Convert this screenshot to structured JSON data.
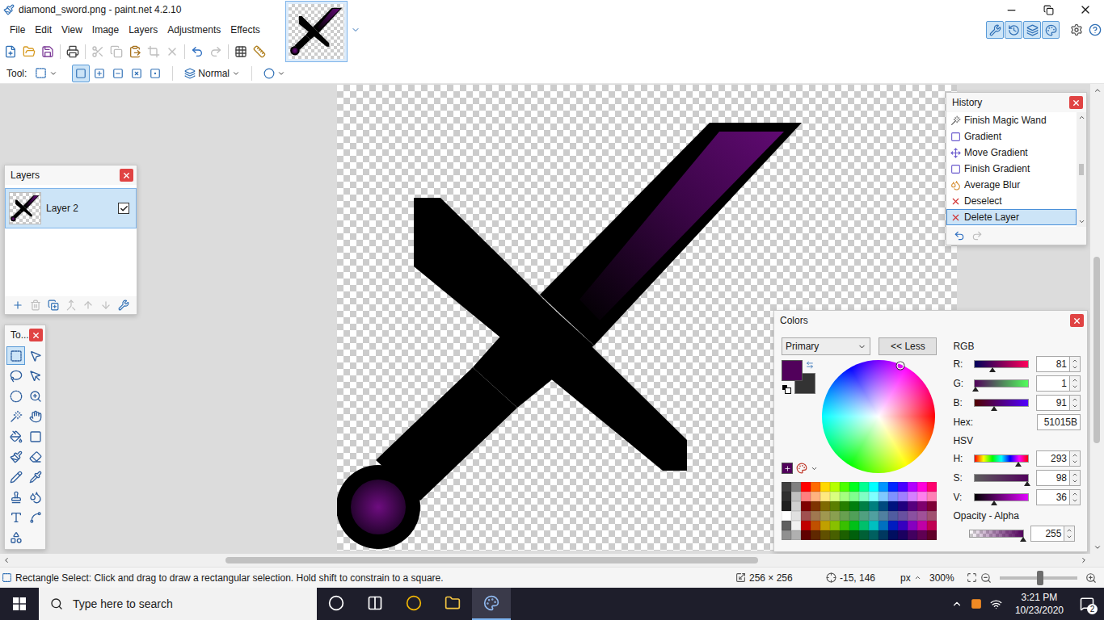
{
  "window": {
    "title": "diamond_sword.png - paint.net 4.2.10"
  },
  "menu": [
    "File",
    "Edit",
    "View",
    "Image",
    "Layers",
    "Adjustments",
    "Effects"
  ],
  "image_tabs": [
    {
      "selected": true
    }
  ],
  "panel_toggles": [
    {
      "selected": true
    },
    {
      "selected": true
    },
    {
      "selected": true
    },
    {
      "selected": true
    }
  ],
  "toolbar": [
    [
      {
        "disabled": false
      },
      {
        "disabled": false
      },
      {
        "disabled": false
      }
    ],
    [
      {
        "disabled": false
      }
    ],
    [
      {
        "disabled": true
      },
      {
        "disabled": true
      },
      {
        "disabled": false
      },
      {
        "disabled": true
      },
      {
        "disabled": true
      }
    ],
    [
      {
        "disabled": false
      },
      {
        "disabled": true
      }
    ],
    [
      {
        "disabled": false
      },
      {
        "disabled": false
      }
    ]
  ],
  "tool_options": {
    "label": "Tool:",
    "modes": [
      {
        "selected": true
      },
      {
        "selected": false
      },
      {
        "selected": false
      },
      {
        "selected": false
      },
      {
        "selected": false
      }
    ],
    "blend_mode": "Normal"
  },
  "layers_panel": {
    "title": "Layers",
    "layers": [
      {
        "name": "Layer 2",
        "visible": true,
        "selected": true
      }
    ],
    "buttons": [
      {
        "disabled": false
      },
      {
        "disabled": true
      },
      {
        "disabled": false
      },
      {
        "disabled": true
      },
      {
        "disabled": true
      },
      {
        "disabled": true
      },
      {
        "disabled": false
      }
    ]
  },
  "tools_panel": {
    "title": "To...",
    "tools": [
      {
        "selected": true
      },
      {
        "selected": false
      },
      {
        "selected": false
      },
      {
        "selected": false
      },
      {
        "selected": false
      },
      {
        "selected": false
      },
      {
        "selected": false
      },
      {
        "selected": false
      },
      {
        "selected": false
      },
      {
        "selected": false
      },
      {
        "selected": false
      },
      {
        "selected": false
      },
      {
        "selected": false
      },
      {
        "selected": false
      },
      {
        "selected": false
      },
      {
        "selected": false
      },
      {
        "selected": false
      },
      {
        "selected": false
      },
      {
        "selected": false
      }
    ]
  },
  "history_panel": {
    "title": "History",
    "items": [
      {
        "label": "Finish Magic Wand",
        "selected": false
      },
      {
        "label": "Gradient",
        "selected": false
      },
      {
        "label": "Move Gradient",
        "selected": false
      },
      {
        "label": "Finish Gradient",
        "selected": false
      },
      {
        "label": "Average Blur",
        "selected": false
      },
      {
        "label": "Deselect",
        "selected": false
      },
      {
        "label": "Delete Layer",
        "selected": true
      }
    ],
    "undo_disabled": false,
    "redo_disabled": true
  },
  "colors_panel": {
    "title": "Colors",
    "target": "Primary",
    "less_button": "<< Less",
    "primary": "#51015B",
    "secondary": "#333333",
    "rgb_label": "RGB",
    "rgb": [
      {
        "label": "R:",
        "value": "81",
        "level": 0.32,
        "kind": "red"
      },
      {
        "label": "G:",
        "value": "1",
        "level": 0.004,
        "kind": "green"
      },
      {
        "label": "B:",
        "value": "91",
        "level": 0.36,
        "kind": "blue"
      }
    ],
    "hex_label": "Hex:",
    "hex": "51015B",
    "hsv_label": "HSV",
    "hsv": [
      {
        "label": "H:",
        "value": "293",
        "level": 0.81,
        "kind": "hue"
      },
      {
        "label": "S:",
        "value": "98",
        "level": 0.98,
        "kind": "saturation"
      },
      {
        "label": "V:",
        "value": "36",
        "level": 0.36,
        "kind": "value"
      }
    ],
    "alpha_label": "Opacity - Alpha",
    "alpha": {
      "value": "255",
      "level": 1
    },
    "palette": [
      [
        "#404040",
        "#808080",
        "#ff0000",
        "#ff6a00",
        "#ffd800",
        "#b6ff00",
        "#4cff00",
        "#00ff21",
        "#00ff90",
        "#00ffff",
        "#0094ff",
        "#0026ff",
        "#4800ff",
        "#b200ff",
        "#ff00dc",
        "#ff006e"
      ],
      [
        "#303030",
        "#c0c0c0",
        "#ff7f7f",
        "#ffb27f",
        "#ffe97f",
        "#daff7f",
        "#a5ff7f",
        "#7fff8e",
        "#7fffc5",
        "#7fffff",
        "#7fc9ff",
        "#7f92ff",
        "#a17fff",
        "#d67fff",
        "#ff7fed",
        "#ff7fb6"
      ],
      [
        "#202020",
        "#d0d0d0",
        "#7f0000",
        "#7f3300",
        "#7f6a00",
        "#5b7f00",
        "#267f00",
        "#007f0e",
        "#007f46",
        "#007f7f",
        "#004a7f",
        "#00137f",
        "#21007f",
        "#57007f",
        "#7f006e",
        "#7f0037"
      ],
      [
        "#ffffff",
        "#e0e0e0",
        "#a05050",
        "#a07850",
        "#a09850",
        "#8aa050",
        "#68a050",
        "#50a058",
        "#50a080",
        "#50a0a0",
        "#5080a0",
        "#505ca0",
        "#6850a0",
        "#8a50a0",
        "#a05098",
        "#a05070"
      ],
      [
        "#606060",
        "#f0f0f0",
        "#c00000",
        "#c05000",
        "#c0a000",
        "#88c000",
        "#38c000",
        "#00c018",
        "#00c06c",
        "#00c0c0",
        "#0070c0",
        "#001cc0",
        "#3600c0",
        "#8600c0",
        "#c000a6",
        "#c00052"
      ],
      [
        "#909090",
        "#b0b0b0",
        "#600000",
        "#602800",
        "#605000",
        "#486000",
        "#1c6000",
        "#00600c",
        "#006036",
        "#006060",
        "#003860",
        "#000e60",
        "#1b0060",
        "#430060",
        "#600053",
        "#600029"
      ]
    ]
  },
  "scrollbars": {
    "vertical": {
      "start": 0.36,
      "size": 0.42
    },
    "horizontal": {
      "start": 0.2,
      "size": 0.5
    }
  },
  "status_bar": {
    "hint": "Rectangle Select: Click and drag to draw a rectangular selection. Hold shift to constrain to a square.",
    "image_size": "256 × 256",
    "cursor": "-15, 146",
    "unit": "px",
    "zoom": "300%",
    "zoom_level": 0.52
  },
  "taskbar": {
    "search_placeholder": "Type here to search",
    "apps": [
      {
        "selected": false
      },
      {
        "selected": false
      },
      {
        "selected": false
      },
      {
        "selected": false
      },
      {
        "selected": true
      }
    ],
    "time": "3:21 PM",
    "date": "10/23/2020",
    "notifications": "2"
  }
}
